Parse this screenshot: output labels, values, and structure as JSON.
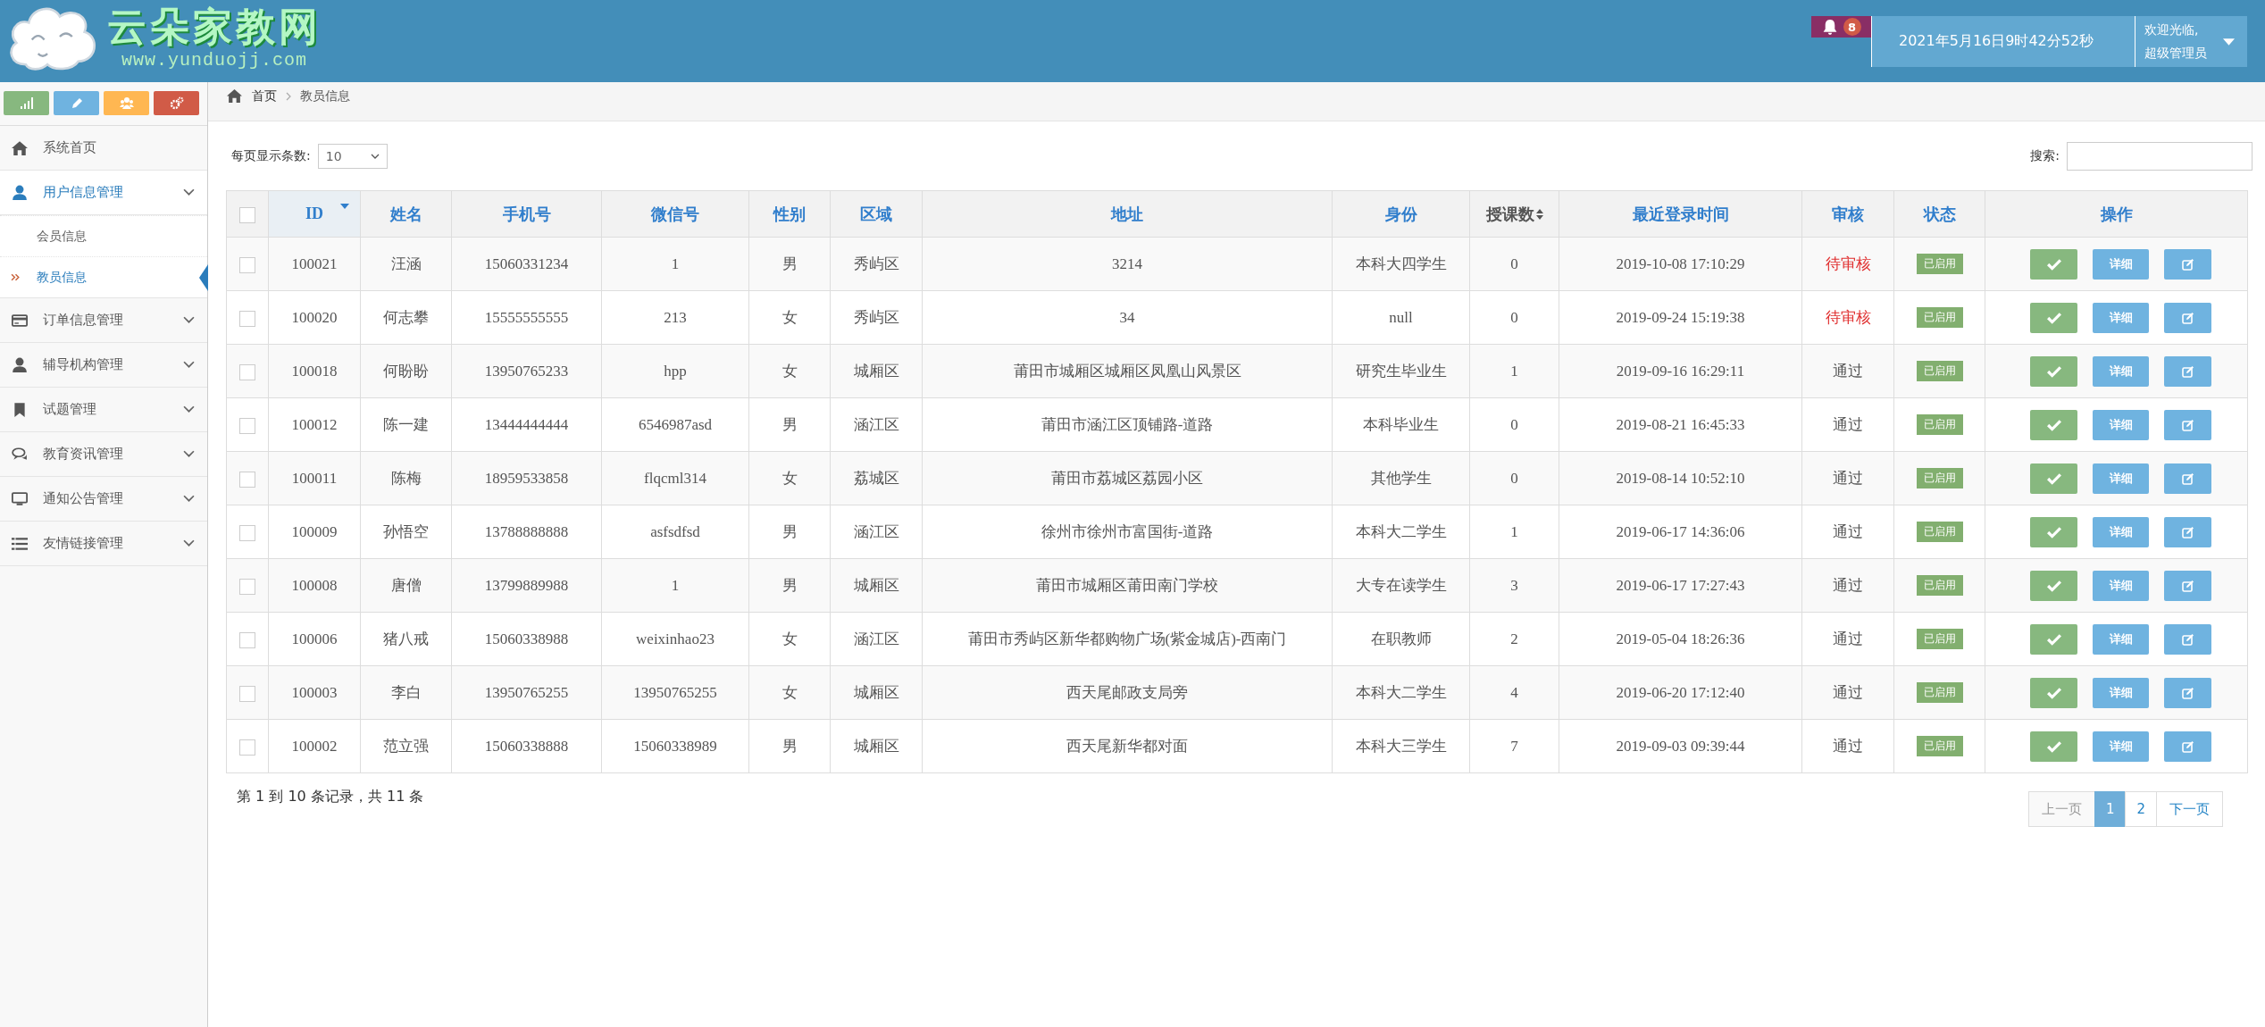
{
  "header": {
    "logo_title": "云朵家教网",
    "logo_url": "www.yunduojj.com",
    "notification_count": "8",
    "datetime": "2021年5月16日9时42分52秒",
    "welcome": "欢迎光临,",
    "user": "超级管理员"
  },
  "sidebar": {
    "items": [
      {
        "label": "系统首页",
        "kind": "link"
      },
      {
        "label": "用户信息管理",
        "kind": "group",
        "expanded": true,
        "children": [
          {
            "label": "会员信息",
            "selected": false
          },
          {
            "label": "教员信息",
            "selected": true
          }
        ]
      },
      {
        "label": "订单信息管理",
        "kind": "group",
        "expanded": false
      },
      {
        "label": "辅导机构管理",
        "kind": "group",
        "expanded": false
      },
      {
        "label": "试题管理",
        "kind": "group",
        "expanded": false
      },
      {
        "label": "教育资讯管理",
        "kind": "group",
        "expanded": false
      },
      {
        "label": "通知公告管理",
        "kind": "group",
        "expanded": false
      },
      {
        "label": "友情链接管理",
        "kind": "group",
        "expanded": false
      }
    ]
  },
  "breadcrumb": [
    "首页",
    "教员信息"
  ],
  "controls": {
    "page_size_label": "每页显示条数:",
    "page_size": "10",
    "search_label": "搜索:"
  },
  "table": {
    "select_all_checked": false,
    "columns": [
      {
        "label": "ID",
        "kind": "sorted"
      },
      {
        "label": "姓名",
        "kind": "plain"
      },
      {
        "label": "手机号",
        "kind": "plain"
      },
      {
        "label": "微信号",
        "kind": "plain"
      },
      {
        "label": "性别",
        "kind": "plain"
      },
      {
        "label": "区域",
        "kind": "plain"
      },
      {
        "label": "地址",
        "kind": "plain"
      },
      {
        "label": "身份",
        "kind": "plain"
      },
      {
        "label": "授课数",
        "kind": "sortable"
      },
      {
        "label": "最近登录时间",
        "kind": "plain"
      },
      {
        "label": "审核",
        "kind": "plain"
      },
      {
        "label": "状态",
        "kind": "plain"
      },
      {
        "label": "操作",
        "kind": "plain"
      }
    ],
    "rows": [
      {
        "checked": false,
        "cells": [
          "100021",
          "汪涵",
          "15060331234",
          "1",
          "男",
          "秀屿区",
          "3214",
          "本科大四学生",
          "0",
          "2019-10-08 17:10:29"
        ],
        "audit": "待审核",
        "audit_pending": true,
        "status": "已启用",
        "enabled": true,
        "detail": "详细"
      },
      {
        "checked": false,
        "cells": [
          "100020",
          "何志攀",
          "15555555555",
          "213",
          "女",
          "秀屿区",
          "34",
          "null",
          "0",
          "2019-09-24 15:19:38"
        ],
        "audit": "待审核",
        "audit_pending": true,
        "status": "已启用",
        "enabled": true,
        "detail": "详细"
      },
      {
        "checked": false,
        "cells": [
          "100018",
          "何盼盼",
          "13950765233",
          "hpp",
          "女",
          "城厢区",
          "莆田市城厢区城厢区凤凰山风景区",
          "研究生毕业生",
          "1",
          "2019-09-16 16:29:11"
        ],
        "audit": "通过",
        "audit_pending": false,
        "status": "已启用",
        "enabled": true,
        "detail": "详细"
      },
      {
        "checked": false,
        "cells": [
          "100012",
          "陈一建",
          "13444444444",
          "6546987asd",
          "男",
          "涵江区",
          "莆田市涵江区顶铺路-道路",
          "本科毕业生",
          "0",
          "2019-08-21 16:45:33"
        ],
        "audit": "通过",
        "audit_pending": false,
        "status": "已启用",
        "enabled": true,
        "detail": "详细"
      },
      {
        "checked": false,
        "cells": [
          "100011",
          "陈梅",
          "18959533858",
          "flqcml314",
          "女",
          "荔城区",
          "莆田市荔城区荔园小区",
          "其他学生",
          "0",
          "2019-08-14 10:52:10"
        ],
        "audit": "通过",
        "audit_pending": false,
        "status": "已启用",
        "enabled": true,
        "detail": "详细"
      },
      {
        "checked": false,
        "cells": [
          "100009",
          "孙悟空",
          "13788888888",
          "asfsdfsd",
          "男",
          "涵江区",
          "徐州市徐州市富国街-道路",
          "本科大二学生",
          "1",
          "2019-06-17 14:36:06"
        ],
        "audit": "通过",
        "audit_pending": false,
        "status": "已启用",
        "enabled": true,
        "detail": "详细"
      },
      {
        "checked": false,
        "cells": [
          "100008",
          "唐僧",
          "13799889988",
          "1",
          "男",
          "城厢区",
          "莆田市城厢区莆田南门学校",
          "大专在读学生",
          "3",
          "2019-06-17 17:27:43"
        ],
        "audit": "通过",
        "audit_pending": false,
        "status": "已启用",
        "enabled": true,
        "detail": "详细"
      },
      {
        "checked": false,
        "cells": [
          "100006",
          "猪八戒",
          "15060338988",
          "weixinhao23",
          "女",
          "涵江区",
          "莆田市秀屿区新华都购物广场(紫金城店)-西南门",
          "在职教师",
          "2",
          "2019-05-04 18:26:36"
        ],
        "audit": "通过",
        "audit_pending": false,
        "status": "已启用",
        "enabled": true,
        "detail": "详细"
      },
      {
        "checked": false,
        "cells": [
          "100003",
          "李白",
          "13950765255",
          "13950765255",
          "女",
          "城厢区",
          "西天尾邮政支局旁",
          "本科大二学生",
          "4",
          "2019-06-20 17:12:40"
        ],
        "audit": "通过",
        "audit_pending": false,
        "status": "已启用",
        "enabled": true,
        "detail": "详细"
      },
      {
        "checked": false,
        "cells": [
          "100002",
          "范立强",
          "15060338888",
          "15060338989",
          "男",
          "城厢区",
          "西天尾新华都对面",
          "本科大三学生",
          "7",
          "2019-09-03 09:39:44"
        ],
        "audit": "通过",
        "audit_pending": false,
        "status": "已启用",
        "enabled": true,
        "detail": "详细"
      }
    ]
  },
  "footer": {
    "summary": "第 1 到 10 条记录，共 11 条",
    "pages": [
      {
        "label": "上一页",
        "kind": "prev",
        "disabled": true,
        "selected": false
      },
      {
        "label": "1",
        "kind": "page",
        "selected": true
      },
      {
        "label": "2",
        "kind": "page",
        "selected": false
      },
      {
        "label": "下一页",
        "kind": "next",
        "disabled": false,
        "selected": false
      }
    ]
  }
}
